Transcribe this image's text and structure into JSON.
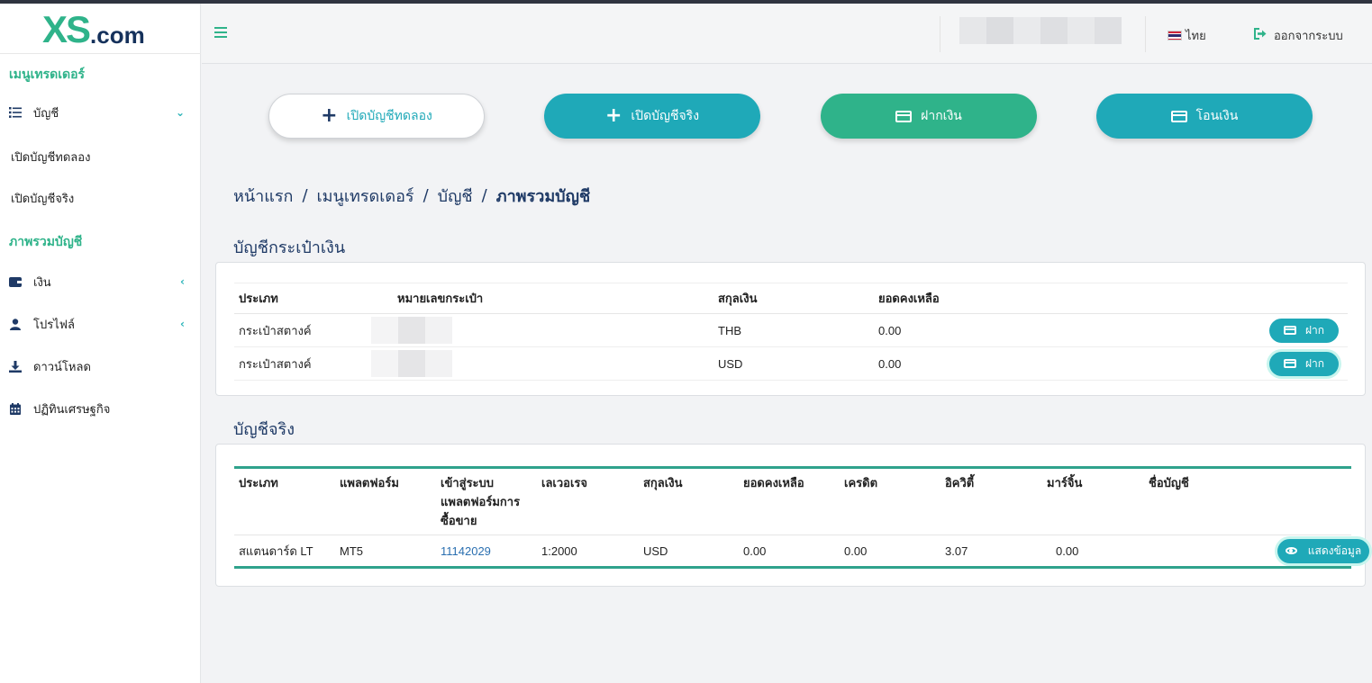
{
  "brand": {
    "logo_main": "XS",
    "logo_suffix": ".com"
  },
  "sidebar": {
    "section_trader": "เมนูเทรดเดอร์",
    "account": "บัญชี",
    "sub_demo": "เปิดบัญชีทดลอง",
    "sub_real": "เปิดบัญชีจริง",
    "section_overview": "ภาพรวมบัญชี",
    "money": "เงิน",
    "profile": "โปรไฟล์",
    "download": "ดาวน์โหลด",
    "calendar": "ปฏิทินเศรษฐกิจ"
  },
  "header": {
    "language": "ไทย",
    "logout": "ออกจากระบบ"
  },
  "actions": {
    "demo": "เปิดบัญชีทดลอง",
    "real": "เปิดบัญชีจริง",
    "deposit": "ฝากเงิน",
    "transfer": "โอนเงิน"
  },
  "breadcrumb": {
    "home": "หน้าแรก",
    "trader": "เมนูเทรดเดอร์",
    "account": "บัญชี",
    "current": "ภาพรวมบัญชี",
    "sep": "/"
  },
  "wallet": {
    "title": "บัญชีกระเป๋าเงิน",
    "columns": [
      "ประเภท",
      "หมายเลขกระเป๋า",
      "สกุลเงิน",
      "ยอดคงเหลือ"
    ],
    "rows": [
      {
        "type": "กระเป๋าสตางค์",
        "currency": "THB",
        "balance": "0.00",
        "action": "ฝาก"
      },
      {
        "type": "กระเป๋าสตางค์",
        "currency": "USD",
        "balance": "0.00",
        "action": "ฝาก"
      }
    ]
  },
  "real": {
    "title": "บัญชีจริง",
    "columns": [
      "ประเภท",
      "แพลตฟอร์ม",
      "เข้าสู่ระบบแพลตฟอร์มการซื้อขาย",
      "เลเวอเรจ",
      "สกุลเงิน",
      "ยอดคงเหลือ",
      "เครดิต",
      "อิควิตี้",
      "มาร์จิ้น",
      "ชื่อบัญชี"
    ],
    "login_header_lines": [
      "เข้าสู่ระบบ",
      "แพลตฟอร์มการ",
      "ซื้อขาย"
    ],
    "rows": [
      {
        "type": "สแตนดาร์ด LT",
        "platform": "MT5",
        "login": "11142029",
        "leverage": "1:2000",
        "currency": "USD",
        "balance": "0.00",
        "credit": "0.00",
        "equity": "3.07",
        "margin": "0.00",
        "name": "",
        "action": "แสดงข้อมูล"
      }
    ]
  },
  "colors": {
    "green": "#2fb38a",
    "teal": "#1fa9b8",
    "navy": "#1f3a66"
  }
}
